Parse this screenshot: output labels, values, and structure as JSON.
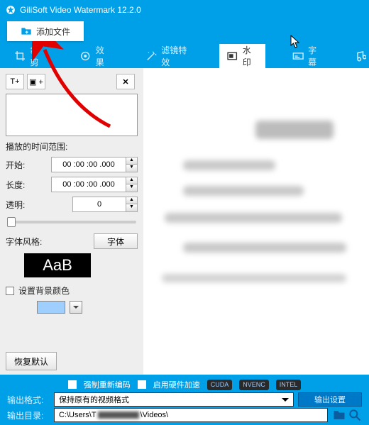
{
  "title": "GiliSoft Video Watermark 12.2.0",
  "toolbar": {
    "add_file": "添加文件"
  },
  "tabs": {
    "t1": "裁剪",
    "t2": "效果",
    "t3": "滤镜特效",
    "t4": "水印",
    "t5": "字幕"
  },
  "panel": {
    "icon_t": "T+",
    "icon_img": "▣ +",
    "icon_close": "✕",
    "range_label": "播放的时间范围:",
    "start_label": "开始:",
    "length_label": "长度:",
    "opacity_label": "透明:",
    "start_value": "00 :00 :00 .000",
    "length_value": "00 :00 :00 .000",
    "opacity_value": "0",
    "fontstyle_label": "字体风格:",
    "font_btn": "字体",
    "preview_text": "AaB",
    "bgcolor_label": "设置背景颜色",
    "restore_btn": "恢复默认"
  },
  "footer": {
    "force_reencode": "强制重新编码",
    "hw_enable": "启用硬件加速",
    "badges": {
      "cuda": "CUDA",
      "nvenc": "NVENC",
      "intel": "INTEL"
    },
    "out_fmt_label": "输出格式:",
    "out_fmt_value": "保持原有的视频格式",
    "out_settings": "输出设置",
    "out_dir_label": "输出目录:",
    "out_dir_value_a": "C:\\Users\\T",
    "out_dir_value_b": "\\Videos\\"
  }
}
